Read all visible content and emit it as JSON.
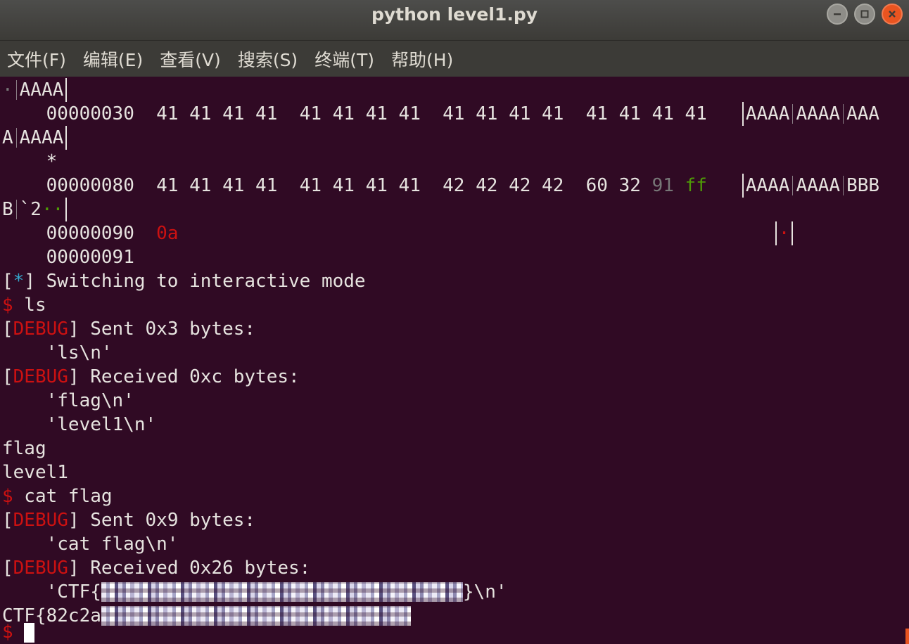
{
  "window": {
    "title": "python level1.py",
    "buttons": {
      "minimize": "minimize-icon",
      "maximize": "maximize-icon",
      "close": "close-icon"
    }
  },
  "menubar": {
    "items": [
      {
        "label": "文件(F)"
      },
      {
        "label": "编辑(E)"
      },
      {
        "label": "查看(V)"
      },
      {
        "label": "搜索(S)"
      },
      {
        "label": "终端(T)"
      },
      {
        "label": "帮助(H)"
      }
    ]
  },
  "colors": {
    "terminal_bg": "#300a24",
    "text": "#e6e3df",
    "debug_red": "#cc1111",
    "star_cyan": "#34a8cc",
    "hex_green": "#4e9a06",
    "hex_dim": "#777777",
    "close_orange": "#e95420"
  },
  "terminal": {
    "l0": {
      "dot": "·",
      "ascii": "AAAA"
    },
    "l1": {
      "offset": "00000030",
      "hex": "41 41 41 41  41 41 41 41  41 41 41 41  41 41 41 41",
      "a1": "AAAA",
      "a2": "AAAA",
      "a3": "AAA"
    },
    "l2": {
      "a": "A",
      "b": "AAAA"
    },
    "l3": {
      "star": "*"
    },
    "l4": {
      "offset": "00000080",
      "hex": "41 41 41 41  41 41 41 41  42 42 42 42  60 32",
      "hex_dim": "91",
      "hex_green": "ff",
      "a1": "AAAA",
      "a2": "AAAA",
      "a3": "BBB"
    },
    "l5": {
      "a": "B",
      "b": "`2",
      "dots": "··"
    },
    "l6": {
      "offset": "00000090",
      "hex": "0a",
      "dot": "·"
    },
    "l7": {
      "offset": "00000091"
    },
    "l8": {
      "open": "[",
      "star": "*",
      "rest": "] Switching to interactive mode"
    },
    "l9": {
      "prompt": "$",
      "cmd": " ls"
    },
    "l10": {
      "open": "[",
      "tag": "DEBUG",
      "rest": "] Sent 0x3 bytes:"
    },
    "l11": {
      "text": "    'ls\\n'"
    },
    "l12": {
      "open": "[",
      "tag": "DEBUG",
      "rest": "] Received 0xc bytes:"
    },
    "l13": {
      "text": "    'flag\\n'"
    },
    "l14": {
      "text": "    'level1\\n'"
    },
    "l15": {
      "text": "flag"
    },
    "l16": {
      "text": "level1"
    },
    "l17": {
      "prompt": "$",
      "cmd": " cat flag"
    },
    "l18": {
      "open": "[",
      "tag": "DEBUG",
      "rest": "] Sent 0x9 bytes:"
    },
    "l19": {
      "text": "    'cat flag\\n'"
    },
    "l20": {
      "open": "[",
      "tag": "DEBUG",
      "rest": "] Received 0x26 bytes:"
    },
    "l21": {
      "prefix": "    'CTF{",
      "suffix": "}\\n'"
    },
    "l22": {
      "prefix": "CTF{82c2a"
    },
    "l23": {
      "prompt": "$"
    }
  }
}
